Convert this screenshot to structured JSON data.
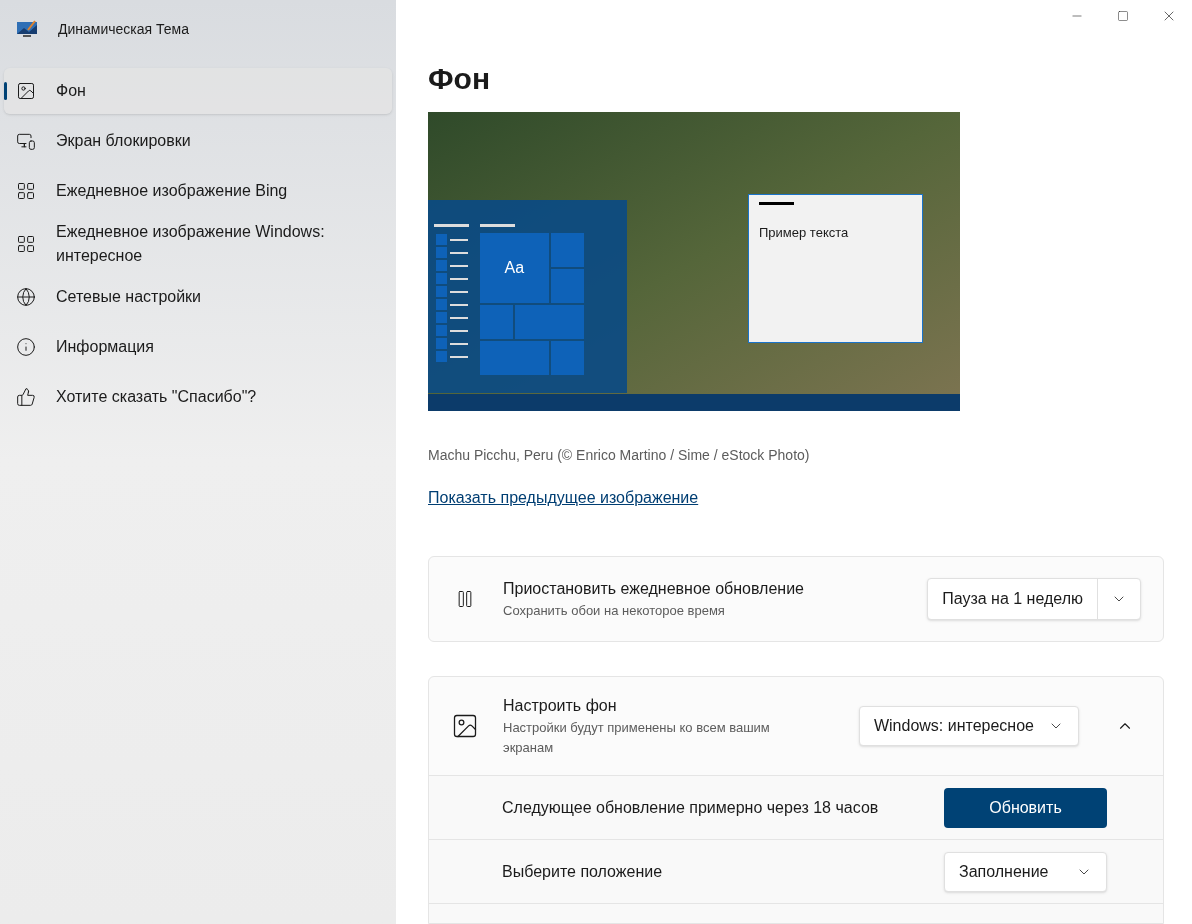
{
  "app": {
    "title": "Динамическая Тема"
  },
  "sidebar": {
    "items": [
      {
        "label": "Фон",
        "selected": true
      },
      {
        "label": "Экран блокировки",
        "selected": false
      },
      {
        "label": "Ежедневное изображение Bing",
        "selected": false
      },
      {
        "label": "Ежедневное изображение Windows: интересное",
        "selected": false
      },
      {
        "label": "Сетевые настройки",
        "selected": false
      },
      {
        "label": "Информация",
        "selected": false
      },
      {
        "label": "Хотите сказать \"Спасибо\"?",
        "selected": false
      }
    ]
  },
  "page": {
    "title": "Фон",
    "preview": {
      "tile_text": "Aa",
      "window_text": "Пример текста"
    },
    "caption": "Machu Picchu, Peru (© Enrico Martino / Sime / eStock Photo)",
    "link": "Показать предыдущее изображение",
    "pause_card": {
      "title": "Приостановить ежедневное обновление",
      "subtitle": "Сохранить обои на некоторое время",
      "value": "Пауза на 1 неделю"
    },
    "background_card": {
      "title": "Настроить фон",
      "subtitle": "Настройки будут применены ко всем вашим экранам",
      "value": "Windows: интересное",
      "expanded": true,
      "rows": [
        {
          "kind": "button",
          "label": "Следующее обновление примерно через 18 часов",
          "value": "Обновить"
        },
        {
          "kind": "dropdown",
          "label": "Выберите положение",
          "value": "Заполнение"
        }
      ]
    }
  }
}
